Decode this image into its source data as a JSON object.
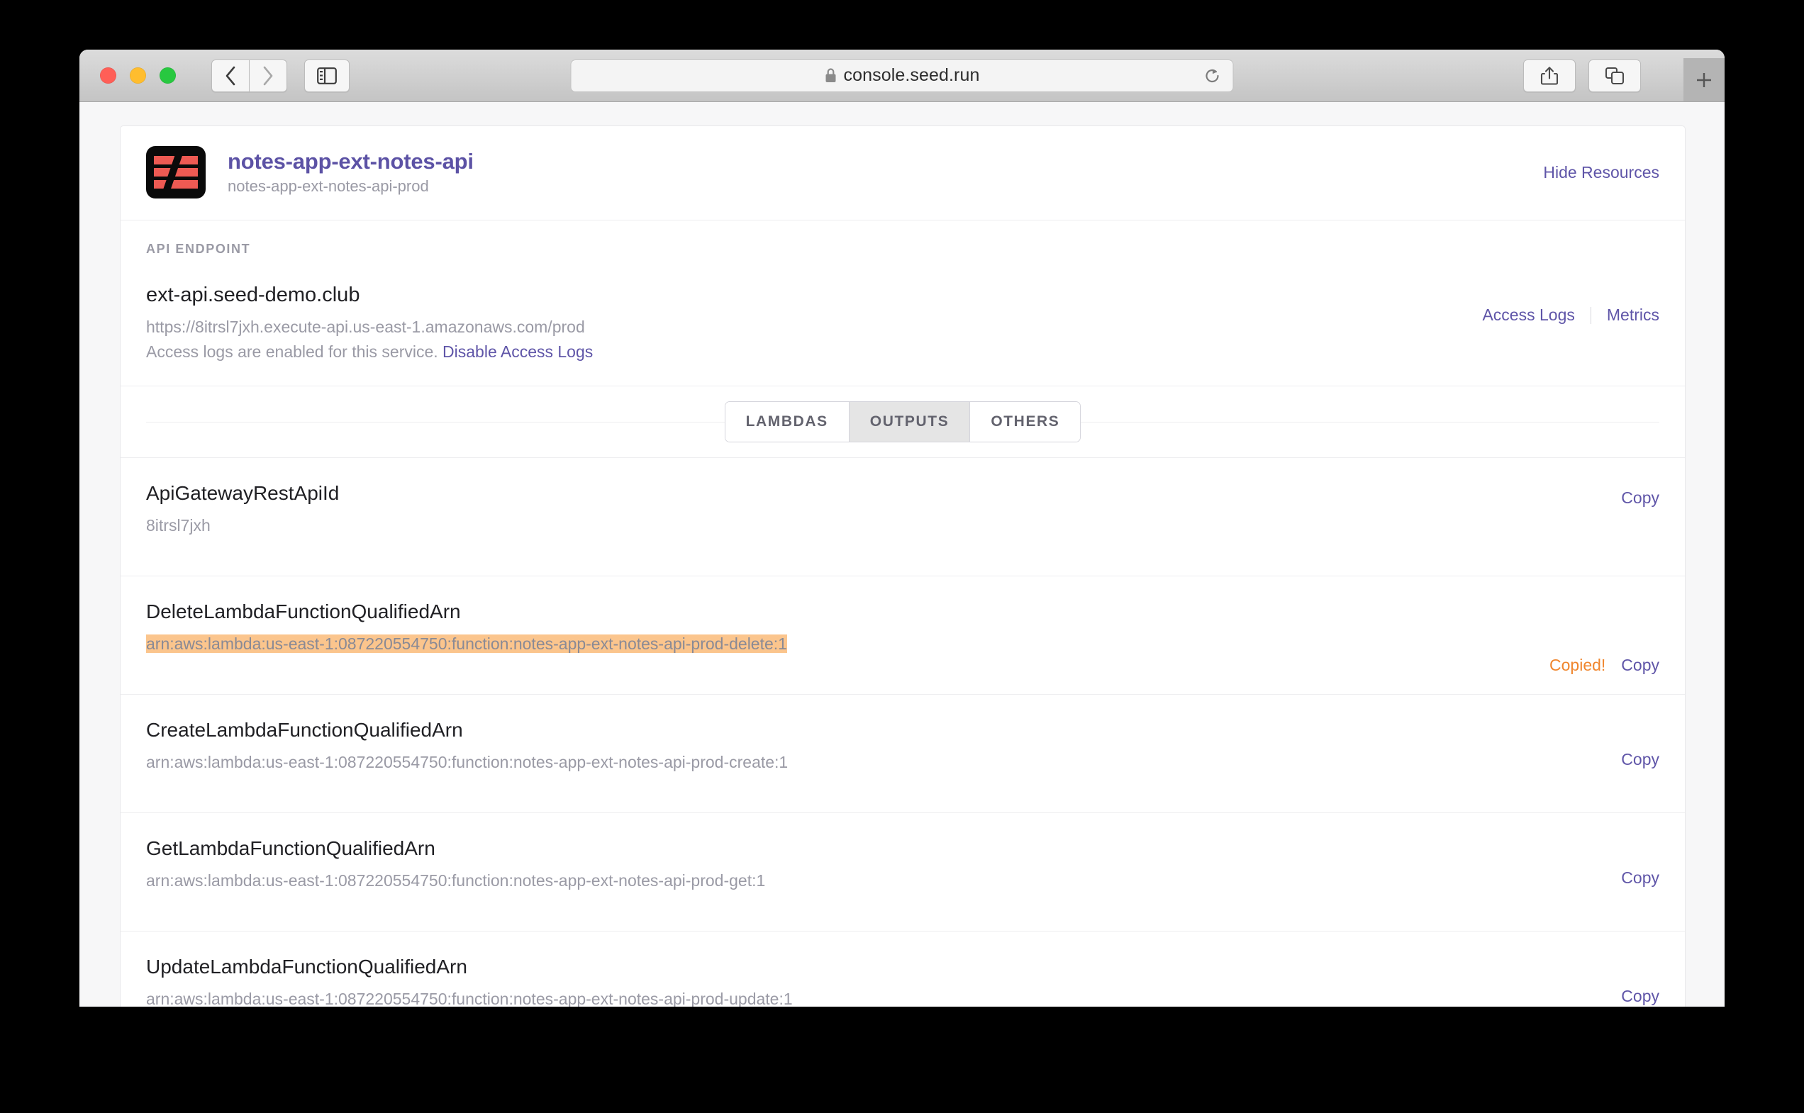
{
  "browser": {
    "url": "console.seed.run",
    "lock_icon": "lock-icon",
    "back_icon": "chevron-left-icon",
    "forward_icon": "chevron-right-icon",
    "sidebar_icon": "sidebar-toggle-icon",
    "reload_icon": "reload-icon",
    "share_icon": "share-icon",
    "tab_overview_icon": "tab-overview-icon",
    "new_tab_icon": "plus-icon"
  },
  "header": {
    "logo_icon": "seed-app-logo",
    "title": "notes-app-ext-notes-api",
    "subtitle": "notes-app-ext-notes-api-prod",
    "hide_resources_label": "Hide Resources"
  },
  "endpoint": {
    "section_label": "API ENDPOINT",
    "domain": "ext-api.seed-demo.club",
    "url": "https://8itrsl7jxh.execute-api.us-east-1.amazonaws.com/prod",
    "note_text": "Access logs are enabled for this service.",
    "note_link": "Disable Access Logs",
    "access_logs_label": "Access Logs",
    "metrics_label": "Metrics"
  },
  "tabs": [
    {
      "label": "LAMBDAS",
      "active": false
    },
    {
      "label": "OUTPUTS",
      "active": true
    },
    {
      "label": "OTHERS",
      "active": false
    }
  ],
  "outputs": [
    {
      "name": "ApiGatewayRestApiId",
      "value": "8itrsl7jxh",
      "highlighted": false,
      "copied": false,
      "copy_label": "Copy"
    },
    {
      "name": "DeleteLambdaFunctionQualifiedArn",
      "value": "arn:aws:lambda:us-east-1:087220554750:function:notes-app-ext-notes-api-prod-delete:1",
      "highlighted": true,
      "copied": true,
      "copied_label": "Copied!",
      "copy_label": "Copy"
    },
    {
      "name": "CreateLambdaFunctionQualifiedArn",
      "value": "arn:aws:lambda:us-east-1:087220554750:function:notes-app-ext-notes-api-prod-create:1",
      "highlighted": false,
      "copied": false,
      "copy_label": "Copy"
    },
    {
      "name": "GetLambdaFunctionQualifiedArn",
      "value": "arn:aws:lambda:us-east-1:087220554750:function:notes-app-ext-notes-api-prod-get:1",
      "highlighted": false,
      "copied": false,
      "copy_label": "Copy"
    },
    {
      "name": "UpdateLambdaFunctionQualifiedArn",
      "value": "arn:aws:lambda:us-east-1:087220554750:function:notes-app-ext-notes-api-prod-update:1",
      "highlighted": false,
      "copied": false,
      "copy_label": "Copy"
    }
  ],
  "colors": {
    "accent_purple": "#5f55a8",
    "copied_orange": "#f0862e",
    "highlight_bg": "#fbc58d",
    "logo_red": "#ee5a53"
  }
}
